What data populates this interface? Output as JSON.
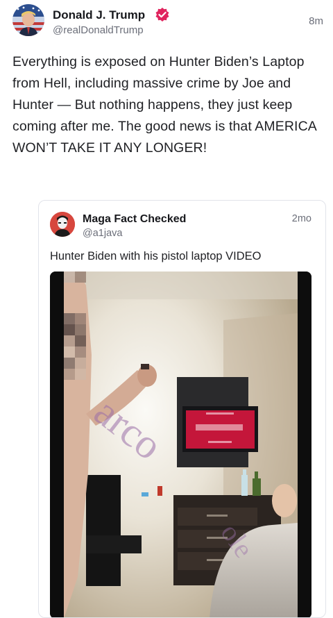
{
  "post": {
    "author_name": "Donald J. Trump",
    "author_handle": "@realDonaldTrump",
    "verified_icon": "verified-badge-icon",
    "time": "8m",
    "text": "Everything is exposed on Hunter Biden’s Laptop from Hell, including massive crime by Joe and Hunter — But nothing happens, they just keep coming after me. The good news is that AMERICA WON’T TAKE IT ANY LONGER!"
  },
  "quote": {
    "author_name": "Maga Fact Checked",
    "author_handle": "@a1java",
    "time": "2mo",
    "text": "Hunter Biden with his pistol laptop VIDEO",
    "media": {
      "type": "video",
      "watermark": "arco"
    }
  },
  "colors": {
    "verified_badge": "#e0245e",
    "text_primary": "#1f2024",
    "text_secondary": "#6b6e79",
    "card_border": "#e1e3ea"
  }
}
